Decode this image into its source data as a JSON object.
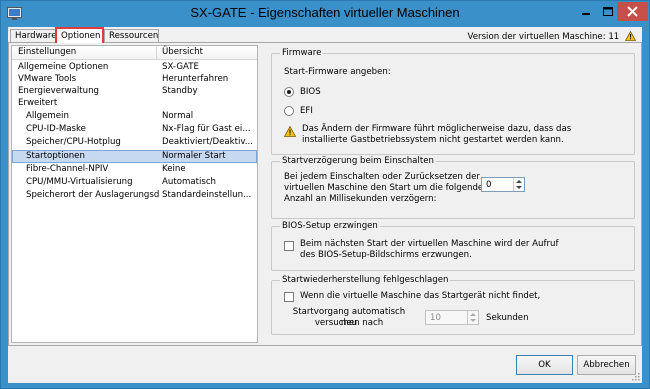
{
  "window": {
    "title": "SX-GATE - Eigenschaften virtueller Maschinen",
    "colors": {
      "titlebar": "#3a90c9",
      "close": "#c74f49",
      "active_tab_outline": "#e23b3b",
      "selection": "#c6d9f0",
      "warning": "#f2c21b"
    }
  },
  "tabs": [
    {
      "label": "Hardware"
    },
    {
      "label": "Optionen"
    },
    {
      "label": "Ressourcen"
    }
  ],
  "version_info": "Version der virtuellen Maschine: 11",
  "list": {
    "header": {
      "col1": "Einstellungen",
      "col2": "Übersicht"
    },
    "rows": [
      {
        "name": "Allgemeine Optionen",
        "value": "SX-GATE"
      },
      {
        "name": "VMware Tools",
        "value": "Herunterfahren"
      },
      {
        "name": "Energieverwaltung",
        "value": "Standby"
      },
      {
        "name": "Erweitert",
        "value": ""
      },
      {
        "name": "Allgemein",
        "value": "Normal"
      },
      {
        "name": "CPU-ID-Maske",
        "value": "Nx-Flag für Gast ei..."
      },
      {
        "name": "Speicher/CPU-Hotplug",
        "value": "Deaktiviert/Deaktiv..."
      },
      {
        "name": "Startoptionen",
        "value": "Normaler Start"
      },
      {
        "name": "Fibre-Channel-NPIV",
        "value": "Keine"
      },
      {
        "name": "CPU/MMU-Virtualisierung",
        "value": "Automatisch"
      },
      {
        "name": "Speicherort der Auslagerungsd...",
        "value": "Standardeinstellun..."
      }
    ]
  },
  "firmware": {
    "title": "Firmware",
    "prompt": "Start-Firmware angeben:",
    "options": [
      {
        "label": "BIOS",
        "selected": true
      },
      {
        "label": "EFI",
        "selected": false
      }
    ],
    "warning_line1": "Das Ändern der Firmware führt möglicherweise dazu, dass das",
    "warning_line2": "installierte Gastbetriebssystem nicht gestartet werden kann."
  },
  "boot_delay": {
    "title": "Startverzögerung beim Einschalten",
    "line1": "Bei jedem Einschalten oder Zurücksetzen der",
    "line2": "virtuellen Maschine den Start um die folgende",
    "line3": "Anzahl an Millisekunden verzögern:",
    "value": "0"
  },
  "bios_setup": {
    "title": "BIOS-Setup erzwingen",
    "line1": "Beim nächsten Start der virtuellen Maschine wird der Aufruf",
    "line2": "des BIOS-Setup-Bildschirms erzwungen.",
    "checked": false
  },
  "boot_retry": {
    "title": "Startwiederherstellung fehlgeschlagen",
    "checkbox_label": "Wenn die virtuelle Maschine das Startgerät nicht findet,",
    "checked": false,
    "retry_line1": "Startvorgang automatisch neu",
    "retry_line2": "versuchen nach",
    "value": "10",
    "unit": "Sekunden"
  },
  "buttons": {
    "ok": "OK",
    "cancel": "Abbrechen"
  }
}
